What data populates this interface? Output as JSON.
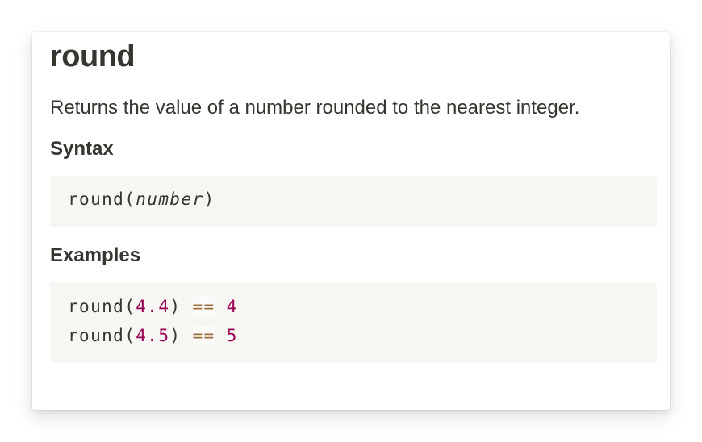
{
  "doc": {
    "title": "round",
    "description": "Returns the value of a number rounded to the nearest integer.",
    "syntax_heading": "Syntax",
    "syntax": {
      "function": "round",
      "open_paren": "(",
      "param": "number",
      "close_paren": ")"
    },
    "examples_heading": "Examples",
    "examples": [
      {
        "function": "round",
        "open_paren": "(",
        "arg": "4.4",
        "close_paren": ")",
        "operator": "==",
        "result": "4"
      },
      {
        "function": "round",
        "open_paren": "(",
        "arg": "4.5",
        "close_paren": ")",
        "operator": "==",
        "result": "5"
      }
    ]
  },
  "colors": {
    "text": "#37352f",
    "code_background": "#f7f6f3",
    "number": "#990055",
    "operator": "#9a6e3a"
  }
}
